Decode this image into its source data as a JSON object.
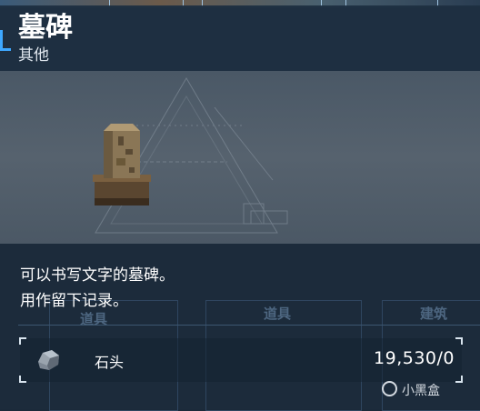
{
  "item": {
    "name": "墓碑",
    "category": "其他",
    "description_lines": [
      "可以书写文字的墓碑。",
      "用作留下记录。"
    ]
  },
  "background_labels": [
    "道具",
    "道具",
    "建筑"
  ],
  "material": {
    "icon": "stone-icon",
    "name": "石头",
    "count": "19,530/0"
  },
  "watermark": {
    "text": "小黑盒",
    "icon": "heybox-logo"
  },
  "colors": {
    "accent": "#3ea8ff",
    "header_bg": "#1e3042",
    "panel_bg": "#1c2b3b"
  }
}
